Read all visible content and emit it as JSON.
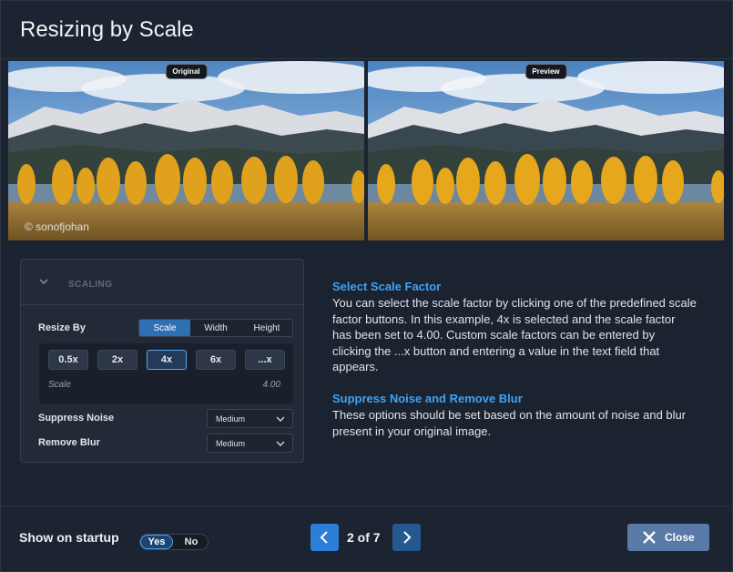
{
  "dialog": {
    "title": "Resizing by Scale"
  },
  "images": {
    "original_label": "Original",
    "preview_label": "Preview",
    "watermark": "© sonofjohan"
  },
  "scaling": {
    "section_label": "SCALING",
    "resize_by_label": "Resize By",
    "modes": [
      "Scale",
      "Width",
      "Height"
    ],
    "active_mode": "Scale",
    "factor_buttons": [
      "0.5x",
      "2x",
      "4x",
      "6x",
      "...x"
    ],
    "active_factor": "4x",
    "scale_label": "Scale",
    "scale_value": "4.00",
    "suppress_noise_label": "Suppress Noise",
    "suppress_noise_value": "Medium",
    "remove_blur_label": "Remove Blur",
    "remove_blur_value": "Medium"
  },
  "description": {
    "heading1": "Select Scale Factor",
    "para1": "You can select the scale factor by clicking one of the predefined scale factor buttons. In this example, 4x is selected and the scale factor has been set to 4.00. Custom scale factors can be entered by clicking the ...x button and entering a value in the text field that appears.",
    "heading2": "Suppress Noise and Remove Blur",
    "para2": "These options should be set based on the amount of noise and blur present in your original image."
  },
  "footer": {
    "startup_label": "Show on startup",
    "yes_label": "Yes",
    "no_label": "No",
    "pager": "2 of 7",
    "close_label": "Close"
  },
  "icons": {
    "collapse": "chevron-down-icon",
    "prev": "chevron-left-icon",
    "next": "chevron-right-icon",
    "close": "x-icon"
  },
  "colors": {
    "accent": "#3fa3f4",
    "primary_button": "#2b7fd8",
    "close_button": "#5979a6",
    "background": "#1b2230"
  }
}
